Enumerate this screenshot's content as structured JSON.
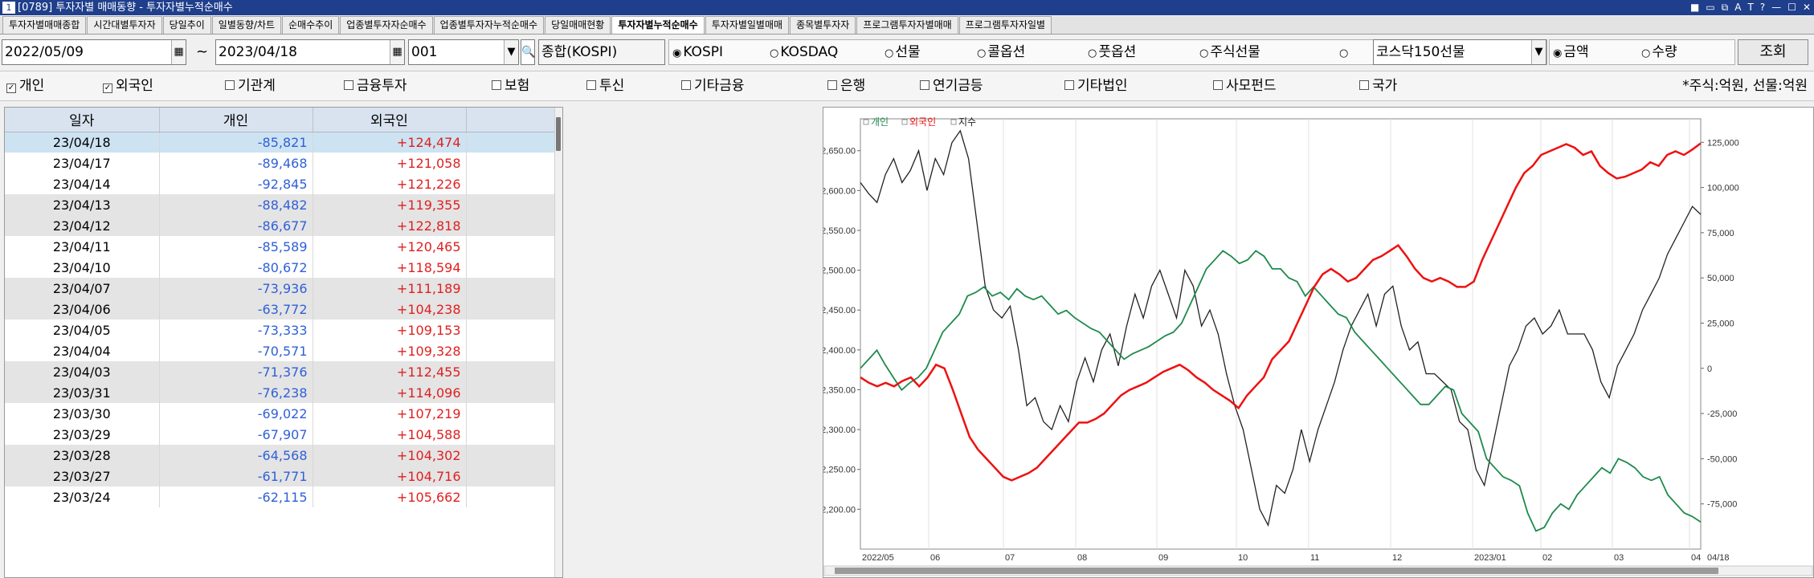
{
  "window": {
    "num": "1",
    "title": "[0789] 투자자별 매매동향 - 투자자별누적순매수",
    "buttons": [
      "■",
      "▭",
      "⧉",
      "A",
      "T",
      "?",
      "—",
      "☐",
      "✕"
    ]
  },
  "tabs": [
    {
      "label": "투자자별매매종합",
      "active": false
    },
    {
      "label": "시간대별투자자",
      "active": false
    },
    {
      "label": "당일추이",
      "active": false
    },
    {
      "label": "일별동향/차트",
      "active": false
    },
    {
      "label": "순매수추이",
      "active": false
    },
    {
      "label": "업종별투자자순매수",
      "active": false
    },
    {
      "label": "업종별투자자누적순매수",
      "active": false
    },
    {
      "label": "당일매매현황",
      "active": false
    },
    {
      "label": "투자자별누적순매수",
      "active": true
    },
    {
      "label": "투자자별일별매매",
      "active": false
    },
    {
      "label": "종목별투자자",
      "active": false
    },
    {
      "label": "프로그램투자자별매매",
      "active": false
    },
    {
      "label": "프로그램투자자일별",
      "active": false
    }
  ],
  "controls": {
    "start_date": "2022/05/09",
    "tilde": "~",
    "end_date": "2023/04/18",
    "code": "001",
    "market_name": "종합(KOSPI)",
    "markets": [
      {
        "label": "KOSPI",
        "selected": true
      },
      {
        "label": "KOSDAQ",
        "selected": false
      },
      {
        "label": "선물",
        "selected": false
      },
      {
        "label": "콜옵션",
        "selected": false
      },
      {
        "label": "풋옵션",
        "selected": false
      },
      {
        "label": "주식선물",
        "selected": false
      },
      {
        "label": "",
        "selected": false
      }
    ],
    "futures_select": "코스닥150선물",
    "amount_label": "금액",
    "amount_selected": true,
    "quantity_label": "수량",
    "query_button": "조회"
  },
  "investors": [
    {
      "label": "개인",
      "checked": true
    },
    {
      "label": "외국인",
      "checked": true
    },
    {
      "label": "기관계",
      "checked": false
    },
    {
      "label": "금융투자",
      "checked": false
    },
    {
      "label": "보험",
      "checked": false
    },
    {
      "label": "투신",
      "checked": false
    },
    {
      "label": "기타금융",
      "checked": false
    },
    {
      "label": "은행",
      "checked": false
    },
    {
      "label": "연기금등",
      "checked": false
    },
    {
      "label": "기타법인",
      "checked": false
    },
    {
      "label": "사모펀드",
      "checked": false
    },
    {
      "label": "국가",
      "checked": false
    }
  ],
  "unit_note": "*주식:억원, 선물:억원",
  "table": {
    "headers": [
      "일자",
      "개인",
      "외국인",
      "",
      "",
      ""
    ],
    "rows": [
      [
        "23/04/18",
        "-85,821",
        "+124,474"
      ],
      [
        "23/04/17",
        "-89,468",
        "+121,058"
      ],
      [
        "23/04/14",
        "-92,845",
        "+121,226"
      ],
      [
        "23/04/13",
        "-88,482",
        "+119,355"
      ],
      [
        "23/04/12",
        "-86,677",
        "+122,818"
      ],
      [
        "23/04/11",
        "-85,589",
        "+120,465"
      ],
      [
        "23/04/10",
        "-80,672",
        "+118,594"
      ],
      [
        "23/04/07",
        "-73,936",
        "+111,189"
      ],
      [
        "23/04/06",
        "-63,772",
        "+104,238"
      ],
      [
        "23/04/05",
        "-73,333",
        "+109,153"
      ],
      [
        "23/04/04",
        "-70,571",
        "+109,328"
      ],
      [
        "23/04/03",
        "-71,376",
        "+112,455"
      ],
      [
        "23/03/31",
        "-76,238",
        "+114,096"
      ],
      [
        "23/03/30",
        "-69,022",
        "+107,219"
      ],
      [
        "23/03/29",
        "-67,907",
        "+104,588"
      ],
      [
        "23/03/28",
        "-64,568",
        "+104,302"
      ],
      [
        "23/03/27",
        "-61,771",
        "+104,716"
      ],
      [
        "23/03/24",
        "-62,115",
        "+105,662"
      ]
    ]
  },
  "chart_data": {
    "type": "line",
    "legend": [
      "개인",
      "외국인",
      "지수"
    ],
    "legend_placement": "top-left",
    "grid": true,
    "x_ticks": [
      "2022/05",
      "06",
      "07",
      "08",
      "09",
      "10",
      "11",
      "12",
      "2023/01",
      "02",
      "03",
      "04",
      "04/18"
    ],
    "left_axis": {
      "ticks": [
        "2,650.00",
        "2,600.00",
        "2,550.00",
        "2,500.00",
        "2,450.00",
        "2,400.00",
        "2,350.00",
        "2,300.00",
        "2,250.00",
        "2,200.00"
      ],
      "range": [
        2150,
        2690
      ]
    },
    "right_axis": {
      "ticks": [
        "125,000",
        "100,000",
        "75,000",
        "50,000",
        "25,000",
        "0",
        "-25,000",
        "-50,000",
        "-75,000"
      ],
      "range": [
        -100000,
        138000
      ]
    },
    "colors": {
      "개인": "#1f8a4c",
      "외국인": "#ee1111",
      "지수": "#222222"
    },
    "series": [
      {
        "name": "지수",
        "axis": "left",
        "values": [
          2610,
          2596,
          2585,
          2620,
          2640,
          2610,
          2625,
          2650,
          2600,
          2640,
          2620,
          2660,
          2675,
          2640,
          2560,
          2480,
          2450,
          2440,
          2455,
          2400,
          2330,
          2340,
          2310,
          2300,
          2330,
          2310,
          2360,
          2390,
          2360,
          2400,
          2420,
          2380,
          2430,
          2470,
          2440,
          2480,
          2500,
          2470,
          2440,
          2500,
          2480,
          2430,
          2450,
          2420,
          2370,
          2330,
          2300,
          2250,
          2200,
          2180,
          2230,
          2220,
          2250,
          2300,
          2260,
          2300,
          2330,
          2360,
          2400,
          2430,
          2450,
          2470,
          2430,
          2470,
          2480,
          2430,
          2400,
          2410,
          2370,
          2370,
          2360,
          2350,
          2310,
          2300,
          2250,
          2230,
          2280,
          2330,
          2380,
          2400,
          2430,
          2440,
          2420,
          2430,
          2450,
          2420,
          2420,
          2420,
          2400,
          2360,
          2340,
          2380,
          2400,
          2420,
          2450,
          2470,
          2490,
          2520,
          2540,
          2560,
          2580,
          2570
        ]
      },
      {
        "name": "개인",
        "axis": "right",
        "values": [
          0,
          5000,
          10000,
          2000,
          -5000,
          -12000,
          -8000,
          -5000,
          0,
          10000,
          20000,
          25000,
          30000,
          40000,
          42000,
          45000,
          40000,
          42000,
          38000,
          44000,
          40000,
          38000,
          40000,
          35000,
          30000,
          32000,
          28000,
          25000,
          22000,
          20000,
          15000,
          10000,
          5000,
          8000,
          10000,
          12000,
          15000,
          18000,
          20000,
          25000,
          35000,
          45000,
          55000,
          60000,
          65000,
          62000,
          58000,
          60000,
          65000,
          62000,
          55000,
          55000,
          50000,
          48000,
          40000,
          45000,
          40000,
          35000,
          30000,
          28000,
          20000,
          15000,
          10000,
          5000,
          0,
          -5000,
          -10000,
          -15000,
          -20000,
          -20000,
          -15000,
          -10000,
          -12000,
          -25000,
          -30000,
          -35000,
          -50000,
          -55000,
          -60000,
          -62000,
          -65000,
          -80000,
          -90000,
          -88000,
          -80000,
          -75000,
          -78000,
          -70000,
          -65000,
          -60000,
          -55000,
          -58000,
          -50000,
          -52000,
          -55000,
          -60000,
          -62000,
          -60000,
          -70000,
          -75000,
          -80000,
          -82000,
          -85000
        ]
      },
      {
        "name": "외국인",
        "axis": "right",
        "values": [
          -5000,
          -8000,
          -10000,
          -8000,
          -10000,
          -7000,
          -5000,
          -10000,
          -5000,
          2000,
          0,
          -12000,
          -25000,
          -38000,
          -45000,
          -50000,
          -55000,
          -60000,
          -62000,
          -60000,
          -58000,
          -55000,
          -50000,
          -45000,
          -40000,
          -35000,
          -30000,
          -30000,
          -28000,
          -25000,
          -20000,
          -15000,
          -12000,
          -10000,
          -8000,
          -5000,
          -2000,
          0,
          2000,
          -1000,
          -5000,
          -8000,
          -12000,
          -15000,
          -18000,
          -22000,
          -15000,
          -10000,
          -5000,
          5000,
          10000,
          15000,
          25000,
          35000,
          45000,
          52000,
          55000,
          52000,
          48000,
          50000,
          55000,
          60000,
          62000,
          65000,
          68000,
          62000,
          55000,
          50000,
          48000,
          50000,
          48000,
          45000,
          45000,
          48000,
          60000,
          70000,
          80000,
          90000,
          100000,
          108000,
          112000,
          118000,
          120000,
          122000,
          124000,
          122000,
          118000,
          120000,
          112000,
          108000,
          105000,
          106000,
          108000,
          110000,
          114000,
          112000,
          118000,
          120000,
          118000,
          121000,
          124474
        ]
      }
    ]
  }
}
